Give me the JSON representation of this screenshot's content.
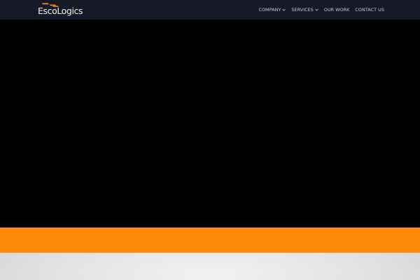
{
  "header": {
    "logo_text": "EscoLogics",
    "logo_mark_color": "#f08a24",
    "background": "#161a26"
  },
  "nav": {
    "items": [
      {
        "label": "COMPANY",
        "has_dropdown": true
      },
      {
        "label": "SERVICES",
        "has_dropdown": true
      },
      {
        "label": "OUR WORK",
        "has_dropdown": false
      },
      {
        "label": "CONTACT US",
        "has_dropdown": false
      }
    ]
  },
  "colors": {
    "hero": "#000000",
    "accent_band": "#ff8a0b",
    "footer_gray": "#e2e2e2"
  }
}
